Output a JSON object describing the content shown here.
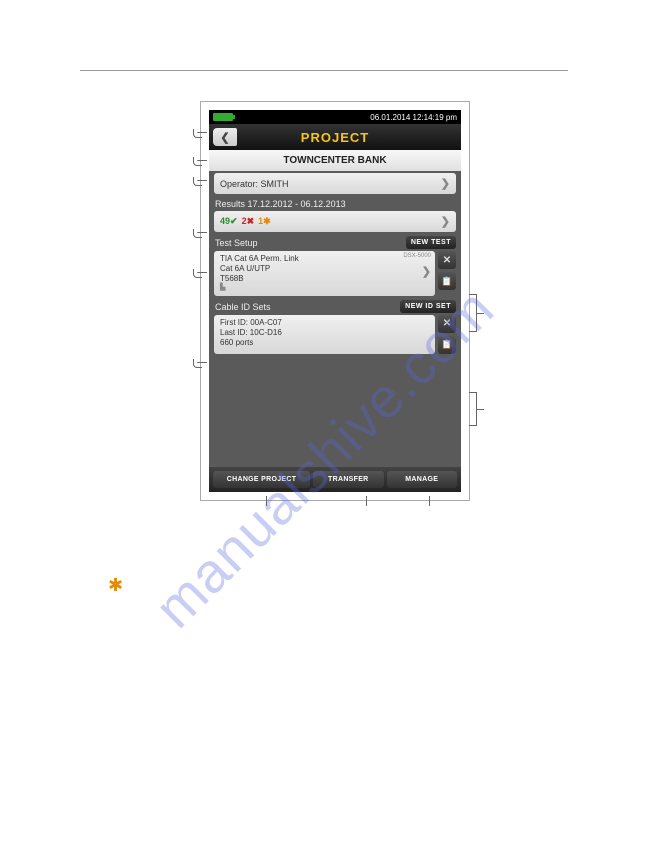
{
  "status": {
    "datetime": "06.01.2014 12:14:19 pm"
  },
  "title": "PROJECT",
  "project_name": "TOWNCENTER BANK",
  "operator": {
    "label": "Operator: SMITH"
  },
  "results": {
    "range": "Results 17.12.2012 - 06.12.2013",
    "pass": "49",
    "fail": "2",
    "warn": "1"
  },
  "test_setup": {
    "label": "Test Setup",
    "new_button": "NEW TEST",
    "module": "DSX-5000",
    "line1": "TIA Cat 6A Perm. Link",
    "line2": "Cat 6A U/UTP",
    "line3": "T568B"
  },
  "cable_ids": {
    "label": "Cable ID Sets",
    "new_button": "NEW ID SET",
    "line1": "First ID: 00A-C07",
    "line2": "Last ID: 10C-D16",
    "line3": "660 ports"
  },
  "bottom": {
    "change_project": "CHANGE PROJECT",
    "transfer": "TRANSFER",
    "manage": "MANAGE"
  },
  "watermark": "manualshive.com",
  "icons": {
    "check": "✔",
    "cross": "✖",
    "star": "✱",
    "clipboard": "📋"
  }
}
